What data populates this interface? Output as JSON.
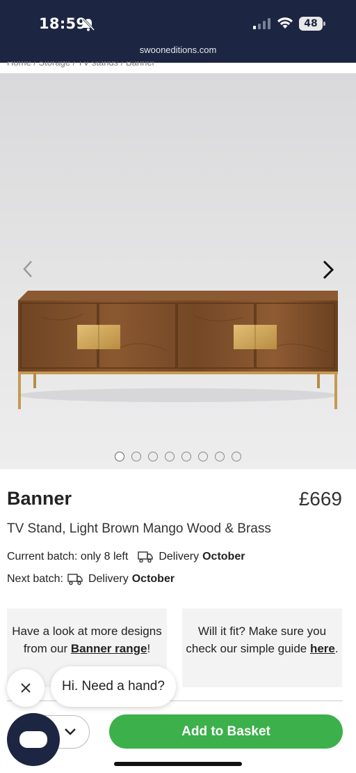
{
  "status_bar": {
    "time": "18:59",
    "battery": "48",
    "url": "swooneditions.com",
    "icons": [
      "bell-slash-icon",
      "signal-icon",
      "wifi-icon",
      "battery-icon"
    ]
  },
  "breadcrumb": "Home / Storage / TV stands / Banner",
  "gallery": {
    "total_images": 8,
    "active_index": 0
  },
  "product": {
    "name": "Banner",
    "price": "£669",
    "description": "TV Stand, Light Brown Mango Wood & Brass"
  },
  "batches": {
    "current_label": "Current batch: only 8 left",
    "current_delivery_label": "Delivery",
    "current_delivery_month": "October",
    "next_label": "Next batch:",
    "next_delivery_label": "Delivery",
    "next_delivery_month": "October"
  },
  "cards": {
    "left_text": "Have a look at more designs from our ",
    "left_link": "Banner range",
    "left_suffix": "!",
    "right_text": "Will it fit? Make sure you check our simple guide ",
    "right_link": "here",
    "right_suffix": "."
  },
  "chat": {
    "prompt": "Hi. Need a hand?"
  },
  "actions": {
    "add_to_basket": "Add to Basket"
  },
  "colors": {
    "header_bg": "#1c2541",
    "accent_green": "#3cb04a"
  }
}
